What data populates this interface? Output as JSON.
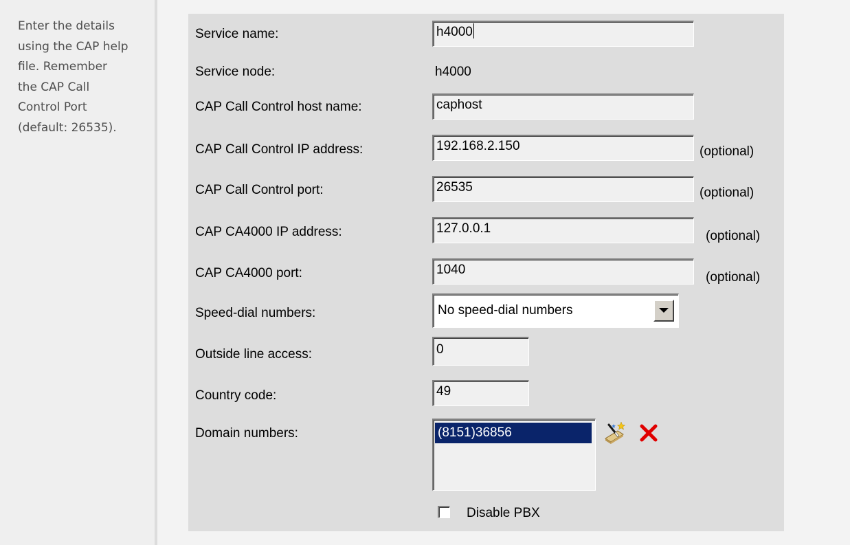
{
  "sidebar": {
    "help_text": "Enter the details\nusing the CAP help\nfile. Remember\nthe CAP Call\nControl Port\n(default: 26535)."
  },
  "form": {
    "service_name": {
      "label": "Service name:",
      "value": "h4000"
    },
    "service_node": {
      "label": "Service node:",
      "value": "h4000"
    },
    "cc_host": {
      "label": "CAP Call Control host name:",
      "value": "caphost"
    },
    "cc_ip": {
      "label": "CAP Call Control IP address:",
      "value": "192.168.2.150",
      "note": "(optional)"
    },
    "cc_port": {
      "label": "CAP Call Control port:",
      "value": "26535",
      "note": "(optional)"
    },
    "ca4000_ip": {
      "label": "CAP CA4000 IP address:",
      "value": "127.0.0.1",
      "note": "(optional)"
    },
    "ca4000_port": {
      "label": "CAP CA4000 port:",
      "value": "1040",
      "note": "(optional)"
    },
    "speed_dial": {
      "label": "Speed-dial numbers:",
      "selected": "No speed-dial numbers"
    },
    "outside_line": {
      "label": "Outside line access:",
      "value": "0"
    },
    "country_code": {
      "label": "Country code:",
      "value": "49"
    },
    "domain_numbers": {
      "label": "Domain numbers:",
      "items": [
        "(8151)36856"
      ]
    },
    "disable_pbx": {
      "label": "Disable PBX",
      "checked": false
    }
  },
  "icons": {
    "edit": "edit-wand-icon",
    "delete": "delete-x-icon"
  },
  "colors": {
    "panel": "#dddddd",
    "selection": "#0a246a",
    "delete_red": "#e00000"
  }
}
